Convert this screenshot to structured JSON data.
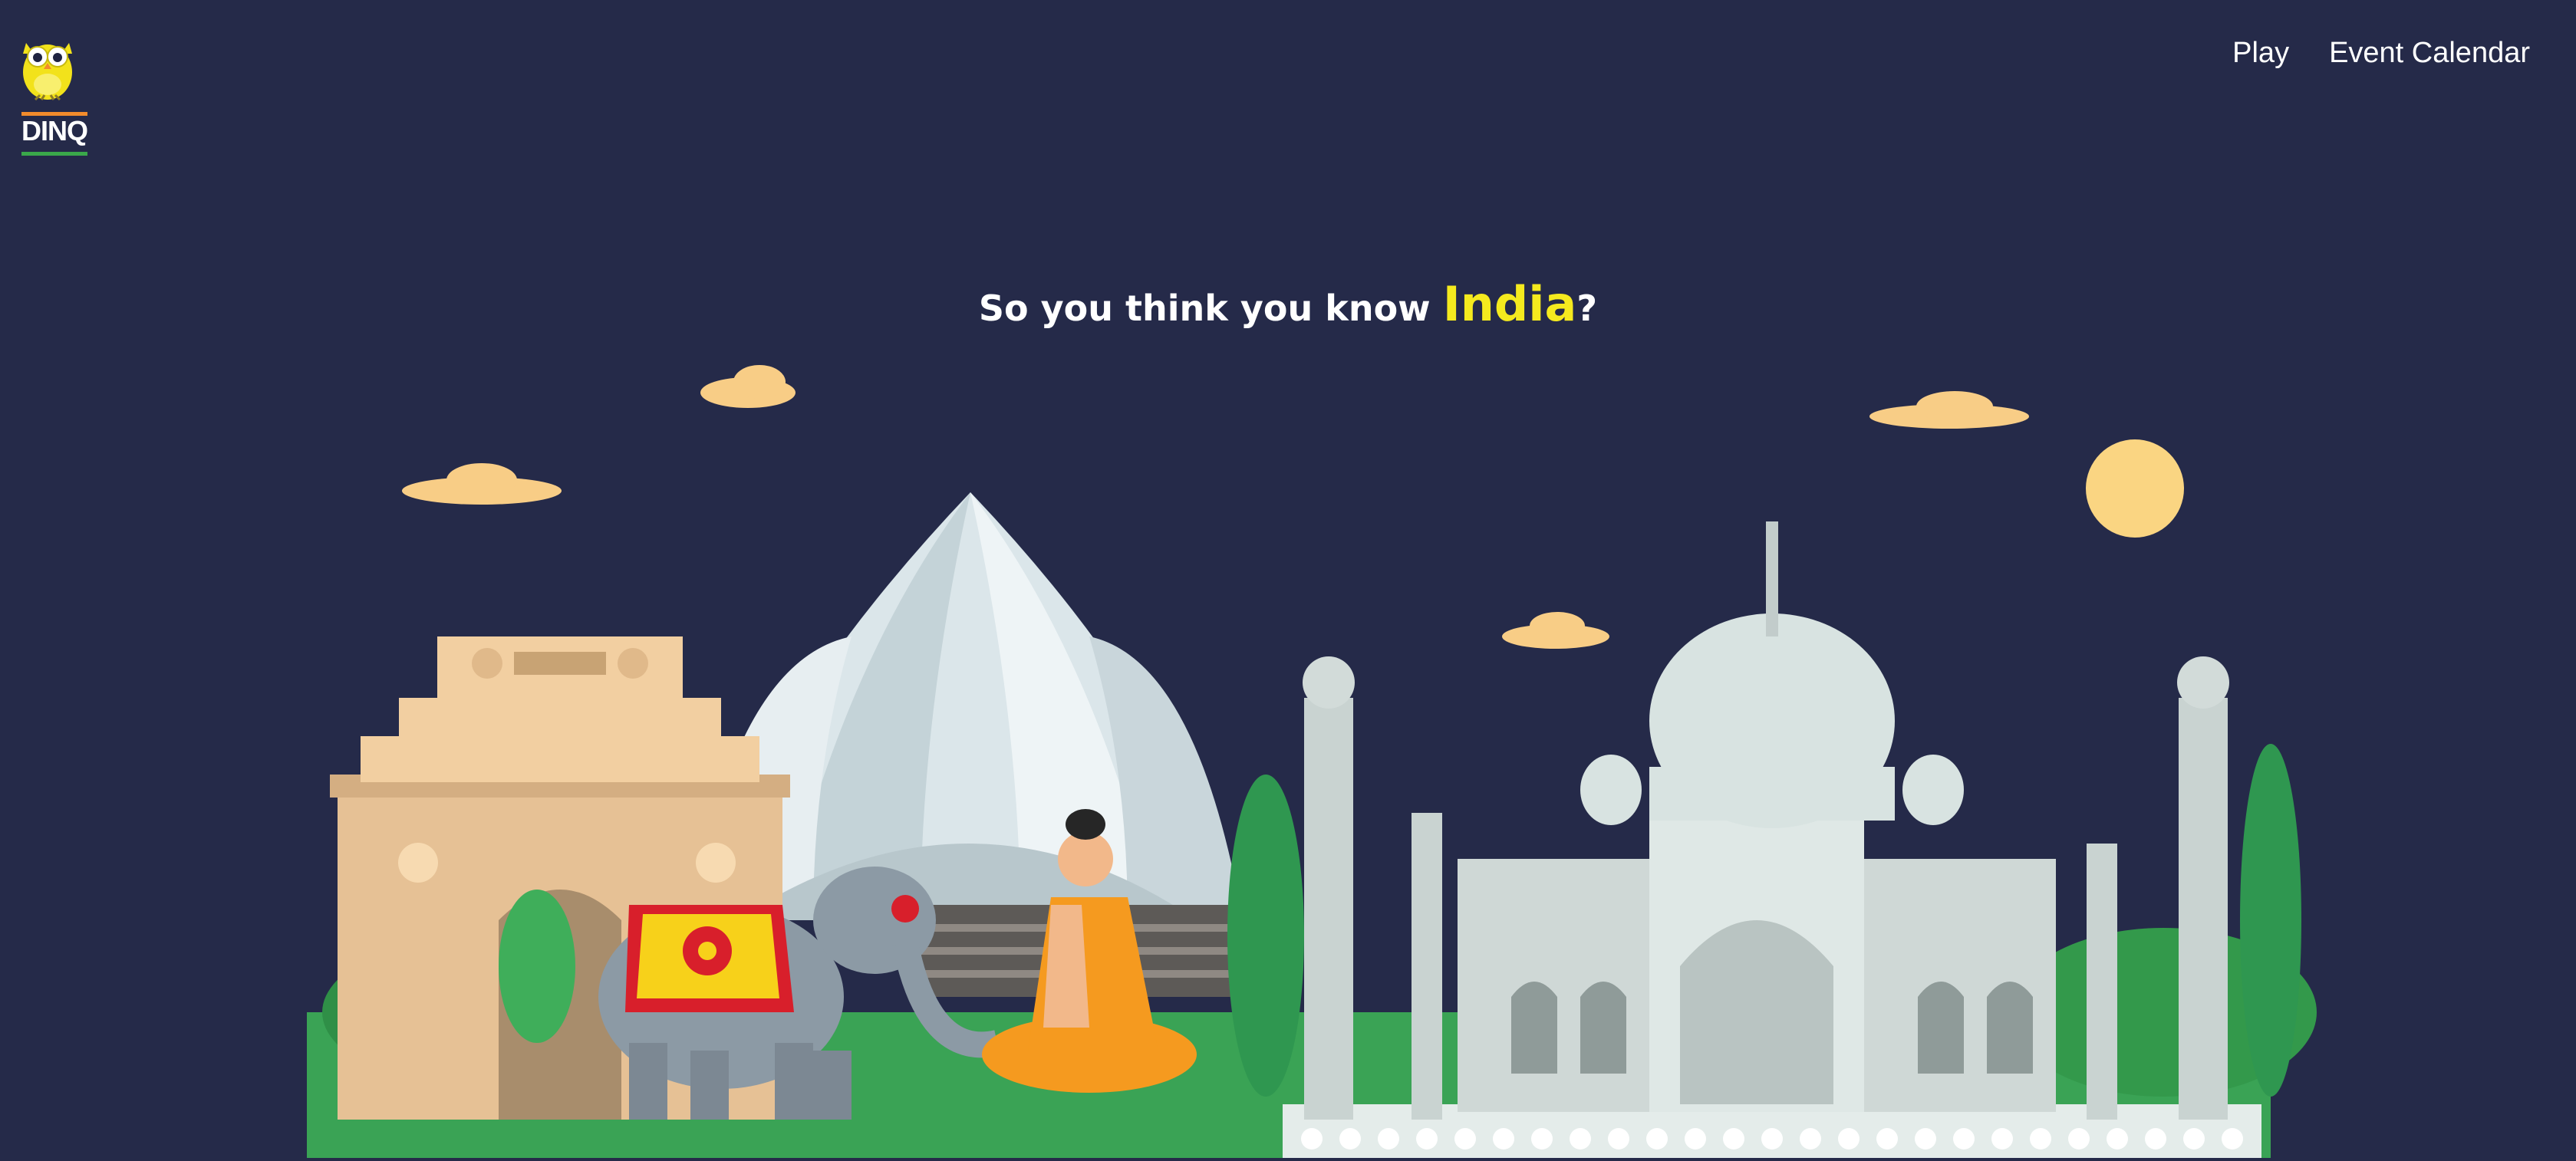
{
  "brand": {
    "name": "DINQ",
    "logo_icon": "owl-icon"
  },
  "nav": {
    "items": [
      {
        "label": "Play"
      },
      {
        "label": "Event Calendar"
      }
    ]
  },
  "hero": {
    "prefix": "So you think you know ",
    "highlight": "India",
    "suffix": "?"
  },
  "colors": {
    "background": "#252a49",
    "highlight": "#f5ea1e",
    "cloud": "#f8cd86",
    "sun": "#fad582",
    "grass": "#3aa355",
    "sandstone": "#e6c195",
    "marble": "#dfe8e6"
  },
  "illustration": {
    "landmarks": [
      "india-gate-icon",
      "lotus-temple-icon",
      "taj-mahal-icon"
    ],
    "figures": [
      "elephant-icon",
      "meditating-monk-icon"
    ]
  }
}
